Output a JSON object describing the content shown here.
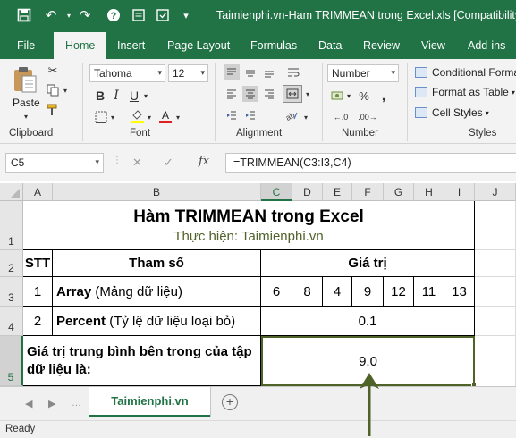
{
  "window": {
    "title": "Taimienphi.vn-Ham TRIMMEAN trong Excel.xls  [Compatibility"
  },
  "tabs": [
    "File",
    "Home",
    "Insert",
    "Page Layout",
    "Formulas",
    "Data",
    "Review",
    "View",
    "Add-ins"
  ],
  "active_tab": "Home",
  "ribbon": {
    "clipboard": {
      "paste_label": "Paste",
      "group_label": "Clipboard"
    },
    "font": {
      "font_name": "Tahoma",
      "font_size": "12",
      "group_label": "Font"
    },
    "alignment": {
      "group_label": "Alignment"
    },
    "number": {
      "format": "Number",
      "group_label": "Number"
    },
    "styles": {
      "conditional": "Conditional Forma",
      "format_table": "Format as Table",
      "cell_styles": "Cell Styles",
      "group_label": "Styles"
    }
  },
  "formula_bar": {
    "name_box": "C5",
    "fx": "fx",
    "formula": "=TRIMMEAN(C3:I3,C4)"
  },
  "grid": {
    "columns": [
      "A",
      "B",
      "C",
      "D",
      "E",
      "F",
      "G",
      "H",
      "I",
      "J"
    ],
    "rows": [
      "1",
      "2",
      "3",
      "4",
      "5"
    ],
    "title": "Hàm TRIMMEAN trong Excel",
    "subtitle": "Thực hiện: Taimienphi.vn",
    "header": {
      "stt": "STT",
      "param": "Tham số",
      "value": "Giá trị"
    },
    "row3": {
      "stt": "1",
      "name_bold": "Array",
      "name_rest": " (Mảng dữ liệu)",
      "values": [
        "6",
        "8",
        "4",
        "9",
        "12",
        "11",
        "13"
      ]
    },
    "row4": {
      "stt": "2",
      "name_bold": "Percent",
      "name_rest": " (Tỷ lệ dữ liệu loại bỏ)",
      "value": "0.1"
    },
    "row5": {
      "label": "Giá trị trung bình bên trong của tập dữ liệu là:",
      "result": "9.0"
    }
  },
  "sheet_tabs": [
    "Taimienphi.vn"
  ],
  "status": {
    "text": "Ready"
  },
  "colors": {
    "excel_green": "#217346",
    "annotation_arrow": "#4f6228"
  }
}
